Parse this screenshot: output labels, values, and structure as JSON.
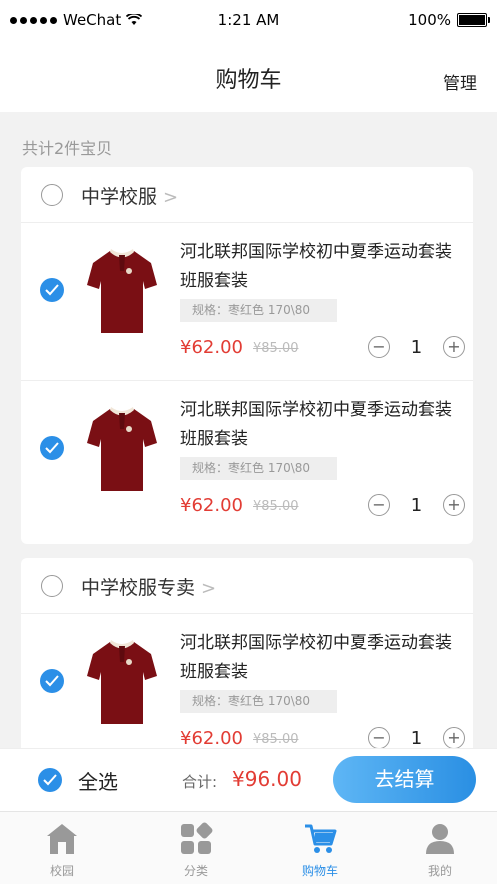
{
  "status_bar": {
    "carrier": "WeChat",
    "time": "1:21 AM",
    "battery": "100%"
  },
  "nav": {
    "title": "购物车",
    "manage": "管理"
  },
  "cart_count": "共计2件宝贝",
  "shops": [
    {
      "name": "中学校服",
      "items": [
        {
          "title": "河北联邦国际学校初中夏季运动套装班服套装",
          "spec": "规格：枣红色  170\\80",
          "price": "¥62.00",
          "original_price": "¥85.00",
          "quantity": "1",
          "checked": true
        },
        {
          "title": "河北联邦国际学校初中夏季运动套装班服套装",
          "spec": "规格：枣红色  170\\80",
          "price": "¥62.00",
          "original_price": "¥85.00",
          "quantity": "1",
          "checked": true
        }
      ]
    },
    {
      "name": "中学校服专卖",
      "items": [
        {
          "title": "河北联邦国际学校初中夏季运动套装班服套装",
          "spec": "规格：枣红色  170\\80",
          "price": "¥62.00",
          "original_price": "¥85.00",
          "quantity": "1",
          "checked": true
        }
      ]
    }
  ],
  "footer": {
    "select_all": "全选",
    "total_label": "合计:",
    "total_value": "¥96.00",
    "checkout": "去结算"
  },
  "tabs": [
    {
      "label": "校园",
      "icon": "school-icon",
      "active": false
    },
    {
      "label": "分类",
      "icon": "category-icon",
      "active": false
    },
    {
      "label": "购物车",
      "icon": "cart-icon",
      "active": true
    },
    {
      "label": "我的",
      "icon": "profile-icon",
      "active": false
    }
  ],
  "colors": {
    "accent": "#2b8fe7",
    "price": "#e23c34",
    "shirt": "#7a0f14"
  }
}
